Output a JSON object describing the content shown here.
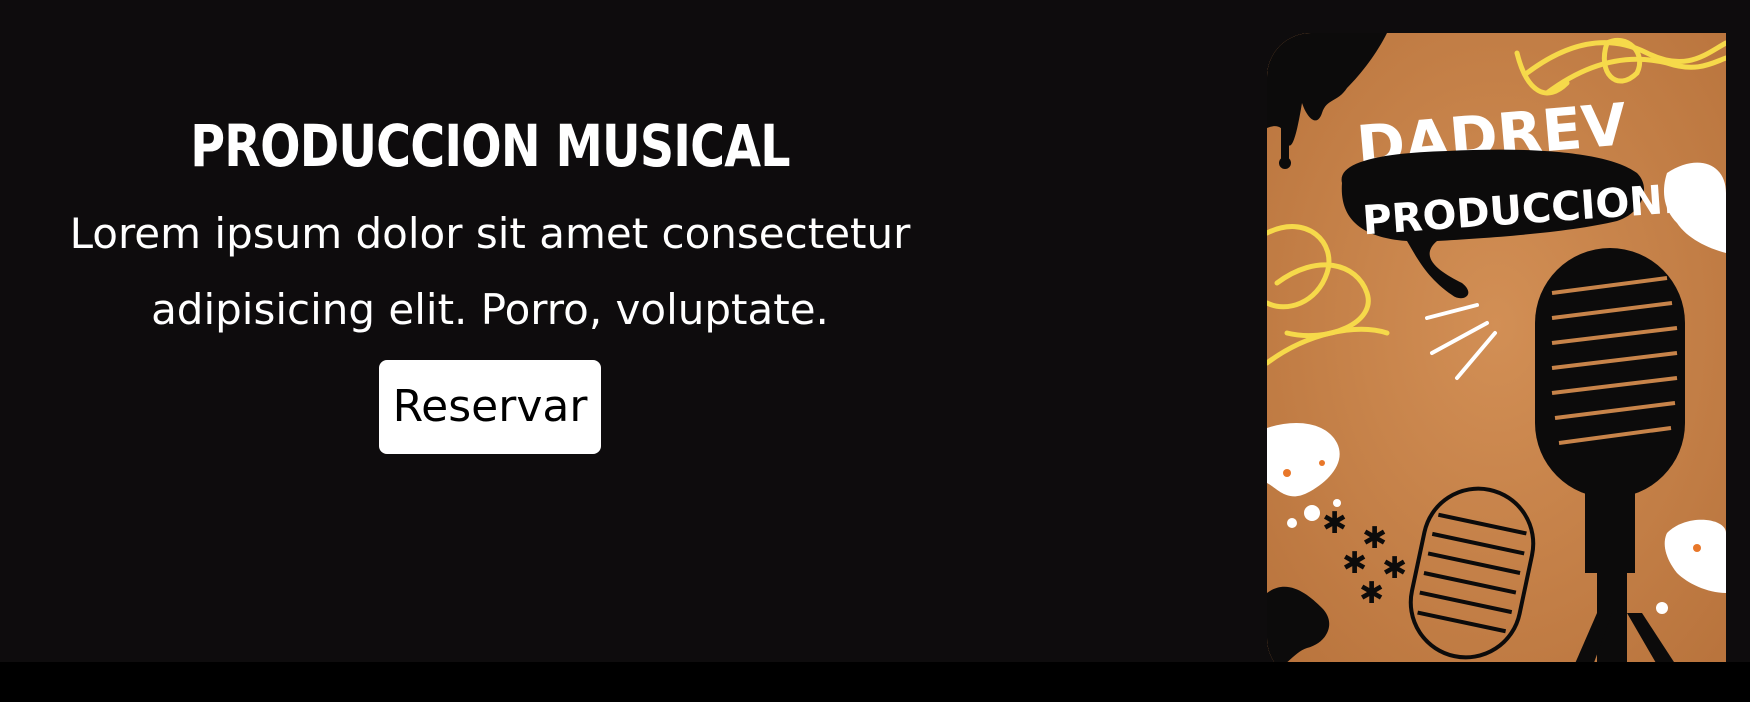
{
  "hero": {
    "title": "PRODUCCION MUSICAL",
    "description": "Lorem ipsum dolor sit amet consectetur adipisicing elit. Porro, voluptate.",
    "button_label": "Reservar"
  },
  "poster": {
    "brand_line1": "DADREV",
    "brand_line2": "PRODUCCIONES",
    "image_subject": "microphone-poster"
  },
  "colors": {
    "background": "#0e0c0d",
    "bottom_bar": "#000000",
    "button_bg": "#ffffff",
    "poster_orange": "#c8844a",
    "poster_yellow": "#f6d94a"
  }
}
